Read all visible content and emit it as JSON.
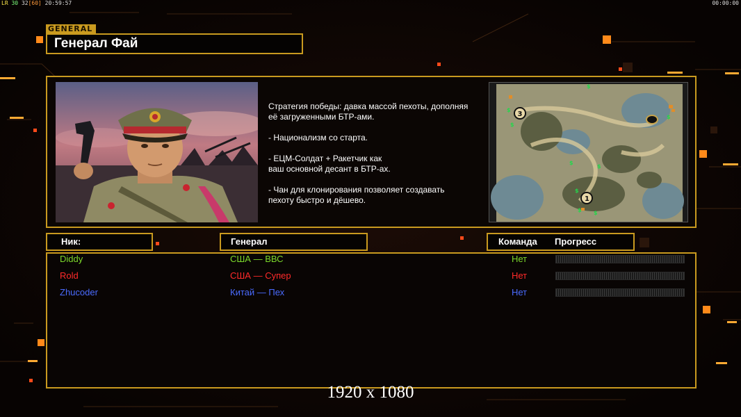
{
  "topbar": {
    "fps_prefix": "LR",
    "fps_a": "30",
    "fps_b": "32",
    "fps_bracket": "[60]",
    "clock": "20:59:57",
    "timer": "00:00:00"
  },
  "general_tag": "GENERAL",
  "general_name": "Генерал Фай",
  "description": [
    "Стратегия победы: давка массой пехоты, дополняя\n её загруженными БТР-ами.",
    "- Национализм со старта.",
    "- ЕЦМ-Солдат + Ракетчик как\nваш основной десант в БТР-ах.",
    "- Чан для клонирования позволяет создавать\n пехоту быстро и дёшево."
  ],
  "headers": {
    "nick": "Ник:",
    "general": "Генерал",
    "team": "Команда",
    "progress": "Прогресс"
  },
  "players": [
    {
      "nick": "Diddy",
      "general": "США — ВВС",
      "team": "Нет",
      "color": "#7cd92b",
      "progress": 0
    },
    {
      "nick": "Rold",
      "general": "США — Супер",
      "team": "Нет",
      "color": "#ff2a2a",
      "progress": 0
    },
    {
      "nick": "Zhucoder",
      "general": "Китай — Пех",
      "team": "Нет",
      "color": "#4a6bff",
      "progress": 0
    }
  ],
  "map_markers": [
    "1",
    "3"
  ],
  "resolution": "1920 x 1080",
  "colors": {
    "accent": "#c99a1f",
    "orange": "#ff8a1a"
  }
}
